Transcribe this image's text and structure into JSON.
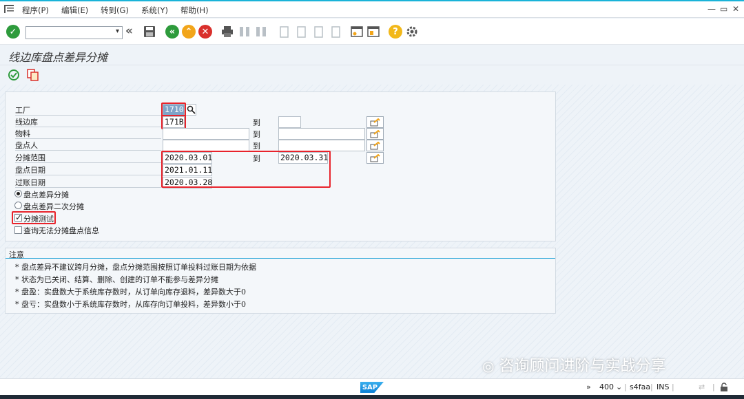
{
  "menu": {
    "items": [
      "程序(P)",
      "编辑(E)",
      "转到(G)",
      "系统(Y)",
      "帮助(H)"
    ]
  },
  "toolbar": {
    "command_value": ""
  },
  "title": "线边库盘点差异分摊",
  "form": {
    "fields": [
      {
        "label": "工厂",
        "value": "1710"
      },
      {
        "label": "线边库",
        "value": "171B",
        "to_label": "到",
        "to_value": ""
      },
      {
        "label": "物料",
        "value": "",
        "to_label": "到",
        "to_value": ""
      },
      {
        "label": "盘点人",
        "value": "",
        "to_label": "到",
        "to_value": ""
      },
      {
        "label": "分摊范围",
        "value": "2020.03.01",
        "to_label": "到",
        "to_value": "2020.03.31"
      },
      {
        "label": "盘点日期",
        "value": "2021.01.11"
      },
      {
        "label": "过账日期",
        "value": "2020.03.28"
      }
    ],
    "radios": [
      {
        "label": "盘点差异分摊",
        "selected": true
      },
      {
        "label": "盘点差异二次分摊",
        "selected": false
      }
    ],
    "checkboxes": [
      {
        "label": "分摊测试",
        "checked": true
      },
      {
        "label": "查询无法分摊盘点信息",
        "checked": false
      }
    ]
  },
  "notes": {
    "heading": "注意",
    "lines": [
      "*  盘点差异不建议跨月分摊，盘点分摊范围按照订单投料过账日期为依据",
      "*  状态为已关闭、结算、删除、创建的订单不能参与差异分摊",
      "*  盘盈：实盘数大于系统库存数时，从订单向库存退料，差异数大于0",
      "*  盘亏：实盘数小于系统库存数时，从库存向订单投料，差异数小于0"
    ]
  },
  "watermark": "咨询顾问进阶与实战分享",
  "status": {
    "logo": "SAP",
    "chevrons": "»",
    "client": "400",
    "system": "s4faa",
    "mode": "INS"
  },
  "colors": {
    "highlight_border": "#e8232b",
    "accent_cyan": "#1ab3d8",
    "ok_green": "#2e9b3c",
    "nav_orange": "#f2a51a",
    "cancel_red": "#d9302c"
  }
}
